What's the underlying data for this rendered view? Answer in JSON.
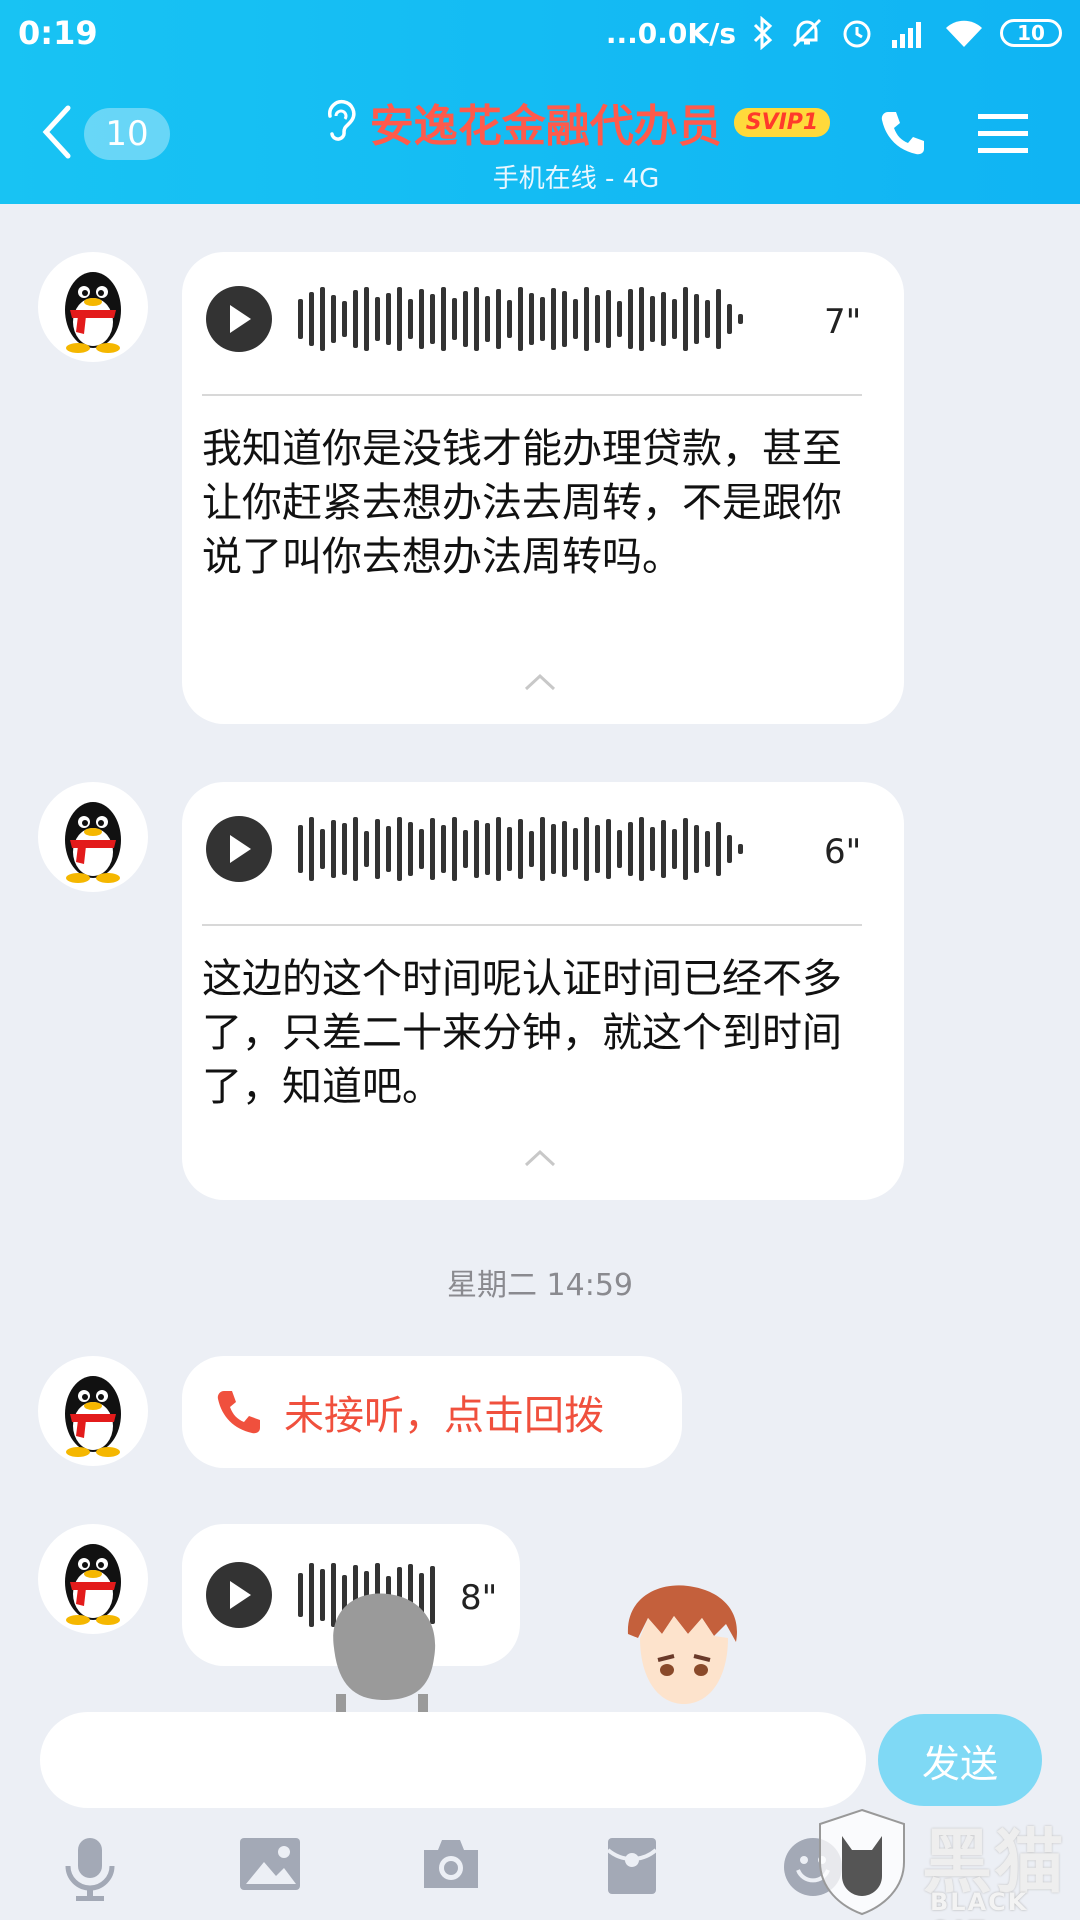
{
  "status_bar": {
    "time": "0:19",
    "network_speed": "...0.0K/s",
    "battery": "10"
  },
  "nav": {
    "unread_count": "10",
    "contact_name": "安逸花金融代办员",
    "vip_label": "SVIP1",
    "subtitle": "手机在线 - 4G"
  },
  "messages": [
    {
      "duration": "7\"",
      "transcript": "我知道你是没钱才能办理贷款，甚至让你赶紧去想办法去周转，不是跟你说了叫你去想办法周转吗。"
    },
    {
      "duration": "6\"",
      "transcript": "这边的这个时间呢认证时间已经不多了，只差二十来分钟，就这个到时间了，知道吧。"
    }
  ],
  "timestamp": "星期二 14:59",
  "missed_call": "未接听，点击回拨",
  "last_voice": {
    "duration": "8\""
  },
  "input": {
    "send_label": "发送"
  },
  "watermark": {
    "cn": "黑猫",
    "en": "BLACK CAT"
  },
  "colors": {
    "header": "#14bcf3",
    "name": "#ff5a4b",
    "missed": "#f0503d",
    "background": "#eceff5"
  }
}
